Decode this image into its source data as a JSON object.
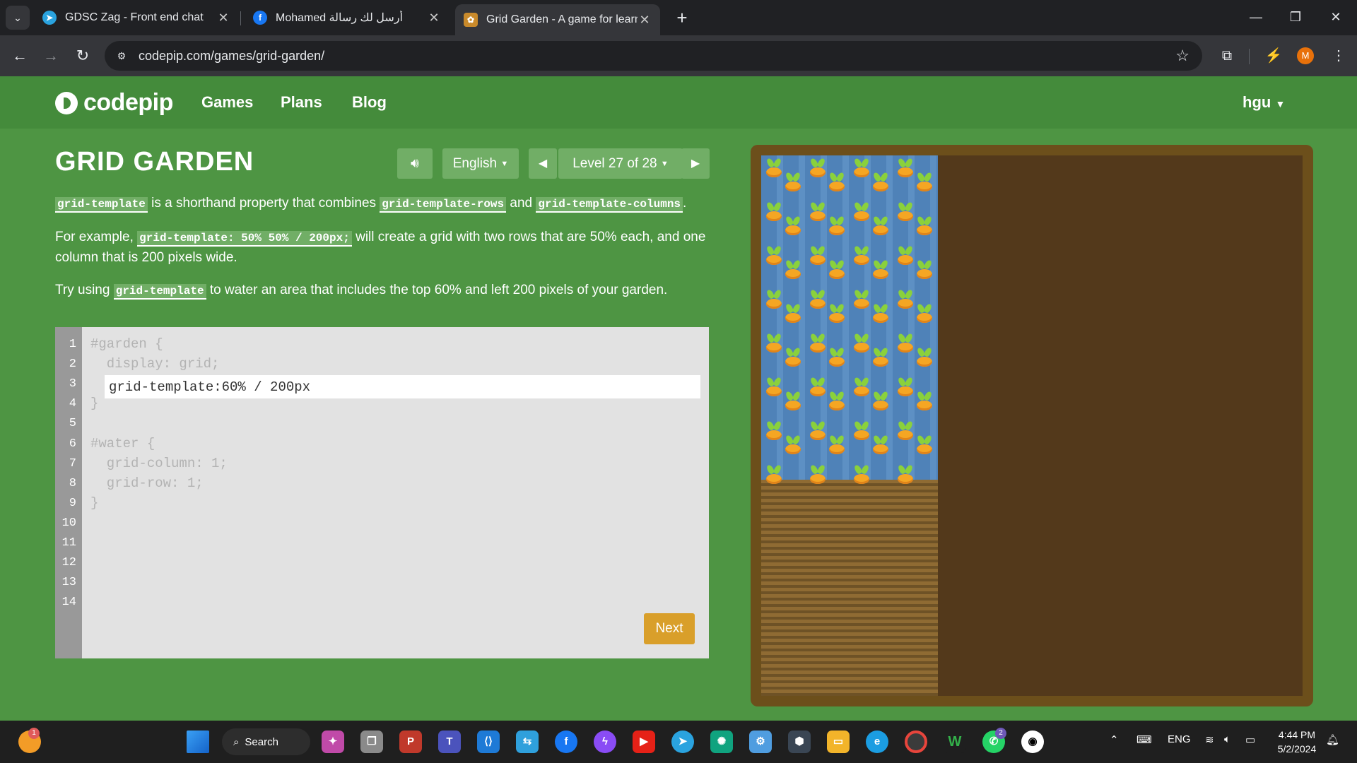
{
  "browser": {
    "tabs": [
      {
        "title": "GDSC Zag - Front end chat",
        "icon": "telegram-icon"
      },
      {
        "title": "Mohamed أرسل لك رسالة",
        "icon": "facebook-icon"
      },
      {
        "title": "Grid Garden - A game for learni",
        "icon": "grid-garden-icon"
      }
    ],
    "url": "codepip.com/games/grid-garden/",
    "profile_initial": "M"
  },
  "site": {
    "logo": "codepip",
    "nav": [
      "Games",
      "Plans",
      "Blog"
    ],
    "user": "hgu"
  },
  "game": {
    "title": "GRID GARDEN",
    "language": "English",
    "level": "Level 27 of 28",
    "instructions": {
      "p1": {
        "code1": "grid-template",
        "text1": " is a shorthand property that combines ",
        "code2": "grid-template-rows",
        "text2": " and ",
        "code3": "grid-template-columns",
        "text3": "."
      },
      "p2": {
        "text1": "For example, ",
        "code1": "grid-template: 50% 50% / 200px;",
        "text2": " will create a grid with two rows that are 50% each, and one column that is 200 pixels wide."
      },
      "p3": {
        "text1": "Try using ",
        "code1": "grid-template",
        "text2": " to water an area that includes the top 60% and left 200 pixels of your garden."
      }
    },
    "editor": {
      "line_numbers": [
        "1",
        "2",
        "3",
        "4",
        "5",
        "6",
        "7",
        "8",
        "9",
        "10",
        "11",
        "12",
        "13",
        "14"
      ],
      "line1": "#garden {",
      "line2": "  display: grid;",
      "input_value": "grid-template:60% / 200px",
      "line4": "}",
      "line6": "#water {",
      "line7": "  grid-column: 1;",
      "line8": "  grid-row: 1;",
      "line9": "}"
    },
    "next_label": "Next"
  },
  "taskbar": {
    "search_label": "Search",
    "tray_lang": "ENG",
    "time": "4:44 PM",
    "date": "5/2/2024",
    "left_badge": "1",
    "whatsapp_badge": "2"
  }
}
